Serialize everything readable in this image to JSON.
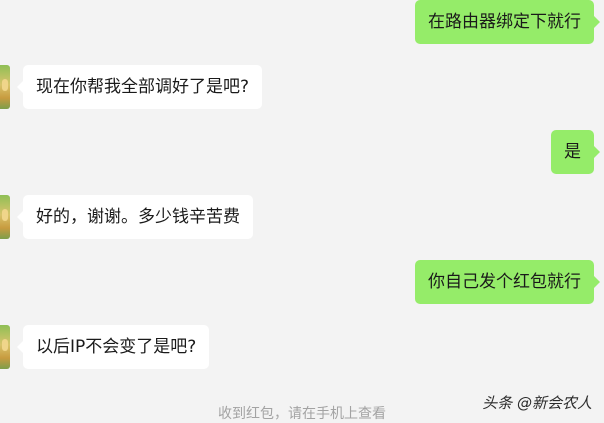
{
  "messages": [
    {
      "side": "right",
      "text": "在路由器绑定下就行"
    },
    {
      "side": "left",
      "text": "现在你帮我全部调好了是吧?"
    },
    {
      "side": "right",
      "text": "是"
    },
    {
      "side": "left",
      "text": "好的，谢谢。多少钱辛苦费"
    },
    {
      "side": "right",
      "text": "你自己发个红包就行"
    },
    {
      "side": "left",
      "text": "以后IP不会变了是吧?"
    }
  ],
  "system_notice": "收到红包，请在手机上查看",
  "watermark": "头条 @新会农人",
  "colors": {
    "background": "#f3f3f3",
    "outgoing_bubble": "#95ec69",
    "incoming_bubble": "#ffffff"
  }
}
